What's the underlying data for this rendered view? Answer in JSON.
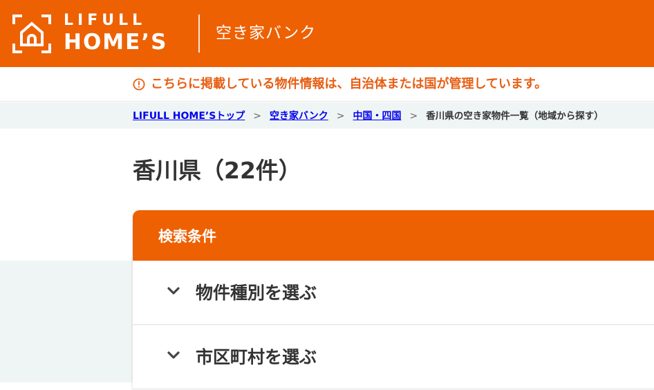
{
  "header": {
    "logo_line1": "LIFULL",
    "logo_line2": "HOME’S",
    "service_name": "空き家バンク",
    "brand_color": "#ed6103"
  },
  "notice": {
    "icon": "info-circle-icon",
    "text": "こちらに掲載している物件情報は、自治体または国が管理しています。",
    "color": "#e75e13"
  },
  "breadcrumb": {
    "items": [
      {
        "label": "LIFULL HOME’Sトップ"
      },
      {
        "label": "空き家バンク"
      },
      {
        "label": "中国・四国"
      }
    ],
    "separator": ">",
    "current": "香川県の空き家物件一覧（地域から探す）"
  },
  "page": {
    "title": "香川県（22件）"
  },
  "search": {
    "title": "検索条件",
    "filters": [
      {
        "label": "物件種別を選ぶ",
        "icon": "chevron-down-icon"
      },
      {
        "label": "市区町村を選ぶ",
        "icon": "chevron-down-icon"
      }
    ]
  }
}
